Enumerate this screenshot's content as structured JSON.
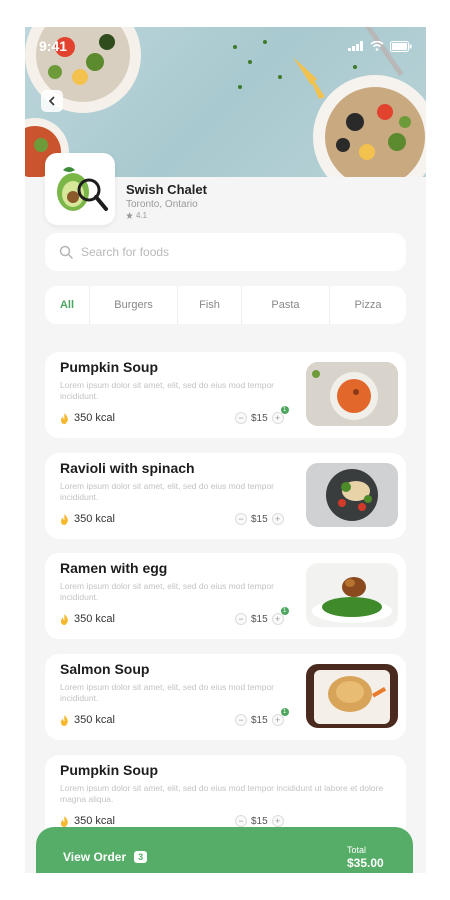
{
  "status_bar": {
    "time": "9:41"
  },
  "restaurant": {
    "name": "Swish Chalet",
    "location": "Toronto, Ontario",
    "rating": "4.1"
  },
  "search": {
    "placeholder": "Search for foods"
  },
  "categories": [
    {
      "label": "All",
      "active": true
    },
    {
      "label": "Burgers"
    },
    {
      "label": "Fish"
    },
    {
      "label": "Pasta"
    },
    {
      "label": "Pizza"
    }
  ],
  "items": [
    {
      "title": "Pumpkin Soup",
      "description": "Lorem ipsum dolor sit amet, elit, sed do eius mod tempor incididunt.",
      "kcal": "350 kcal",
      "price": "$15",
      "qty": "1",
      "image": "pumpkin-soup-photo"
    },
    {
      "title": "Ravioli with spinach",
      "description": "Lorem ipsum dolor sit amet, elit, sed do eius mod tempor incididunt.",
      "kcal": "350 kcal",
      "price": "$15",
      "qty": "",
      "image": "ravioli-photo"
    },
    {
      "title": "Ramen with egg",
      "description": "Lorem ipsum dolor sit amet, elit, sed do eius mod tempor incididunt.",
      "kcal": "350 kcal",
      "price": "$15",
      "qty": "1",
      "image": "ramen-photo"
    },
    {
      "title": "Salmon Soup",
      "description": "Lorem ipsum dolor sit amet, elit, sed do eius mod tempor incididunt.",
      "kcal": "350 kcal",
      "price": "$15",
      "qty": "1",
      "image": "salmon-photo"
    },
    {
      "title": "Pumpkin Soup",
      "description": "Lorem ipsum dolor sit amet, elit, sed do eius mod tempor incididunt ut labore et dolore magna aliqua.",
      "kcal": "350 kcal",
      "price": "$15",
      "qty": "",
      "image": ""
    }
  ],
  "order": {
    "label": "View Order",
    "count": "3",
    "total_label": "Total",
    "total_value": "$35.00"
  },
  "colors": {
    "accent": "#55ad67",
    "background": "#f4f5f4"
  }
}
